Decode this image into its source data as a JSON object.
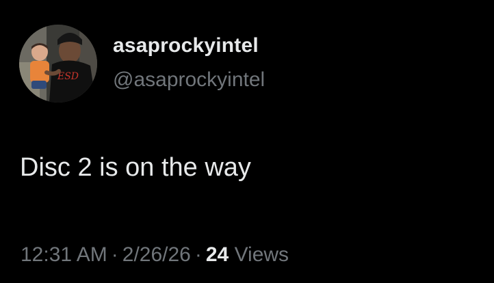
{
  "author": {
    "display_name": "asaprockyintel",
    "handle": "@asaprockyintel",
    "avatar_icon": "profile-photo-avatar"
  },
  "tweet": {
    "text": "Disc 2 is on the way"
  },
  "meta": {
    "time": "12:31 AM",
    "separator": "·",
    "date": "2/26/26",
    "views_count": "24",
    "views_label": "Views"
  },
  "colors": {
    "background": "#000000",
    "primary_text": "#e7e9ea",
    "secondary_text": "#71767b"
  }
}
